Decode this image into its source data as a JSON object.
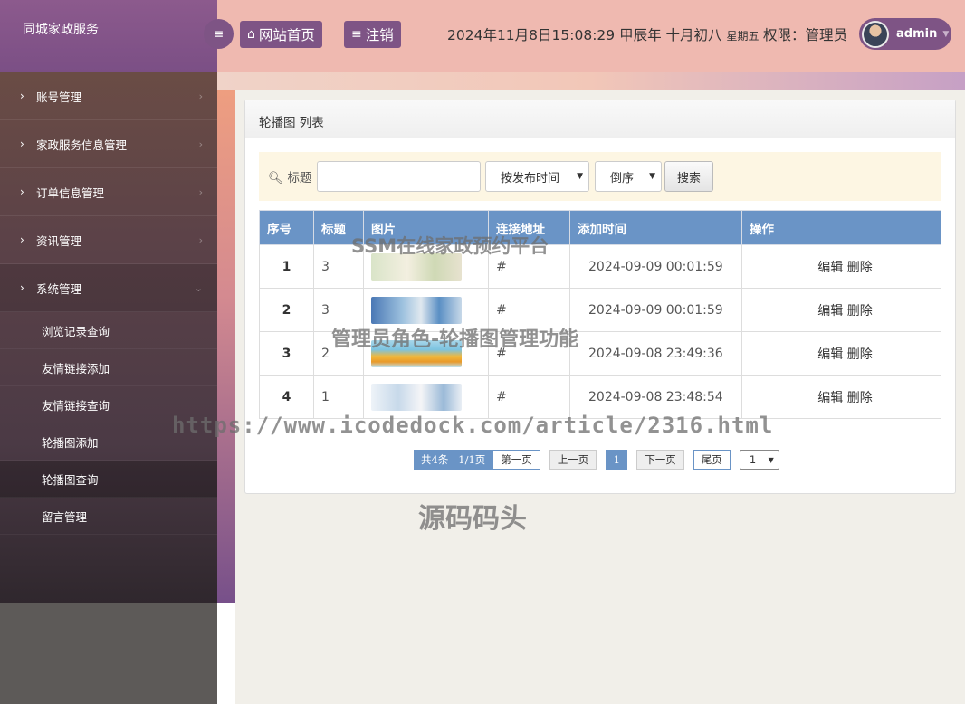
{
  "brand": "同城家政服务",
  "sidebar": {
    "items": [
      {
        "label": "账号管理"
      },
      {
        "label": "家政服务信息管理"
      },
      {
        "label": "订单信息管理"
      },
      {
        "label": "资讯管理"
      },
      {
        "label": "系统管理"
      }
    ],
    "sub_items": [
      {
        "label": "浏览记录查询"
      },
      {
        "label": "友情链接添加"
      },
      {
        "label": "友情链接查询"
      },
      {
        "label": "轮播图添加"
      },
      {
        "label": "轮播图查询"
      },
      {
        "label": "留言管理"
      }
    ]
  },
  "header": {
    "home_label": "网站首页",
    "logout_label": "注销",
    "datetime": "2024年11月8日15:08:29 甲辰年 十月初八",
    "weekday": "星期五",
    "permission": "权限：管理员",
    "username": "admin"
  },
  "panel": {
    "title": "轮播图 列表"
  },
  "search": {
    "label": "标题",
    "sort_field": "按发布时间",
    "sort_order": "倒序",
    "button": "搜索"
  },
  "table": {
    "headers": [
      "序号",
      "标题",
      "图片",
      "连接地址",
      "添加时间",
      "操作"
    ],
    "rows": [
      {
        "idx": "1",
        "title": "3",
        "link": "#",
        "time": "2024-09-09 00:01:59",
        "edit": "编辑",
        "del": "删除"
      },
      {
        "idx": "2",
        "title": "3",
        "link": "#",
        "time": "2024-09-09 00:01:59",
        "edit": "编辑",
        "del": "删除"
      },
      {
        "idx": "3",
        "title": "2",
        "link": "#",
        "time": "2024-09-08 23:49:36",
        "edit": "编辑",
        "del": "删除"
      },
      {
        "idx": "4",
        "title": "1",
        "link": "#",
        "time": "2024-09-08 23:48:54",
        "edit": "编辑",
        "del": "删除"
      }
    ]
  },
  "pager": {
    "total": "共4条",
    "pages": "1/1页",
    "first": "第一页",
    "prev": "上一页",
    "current": "1",
    "next": "下一页",
    "last": "尾页",
    "select": "1"
  },
  "watermarks": {
    "w1": "SSM在线家政预约平台",
    "w2": "管理员角色-轮播图管理功能",
    "w3": "https://www.icodedock.com/article/2316.html",
    "w4": "源码码头"
  }
}
